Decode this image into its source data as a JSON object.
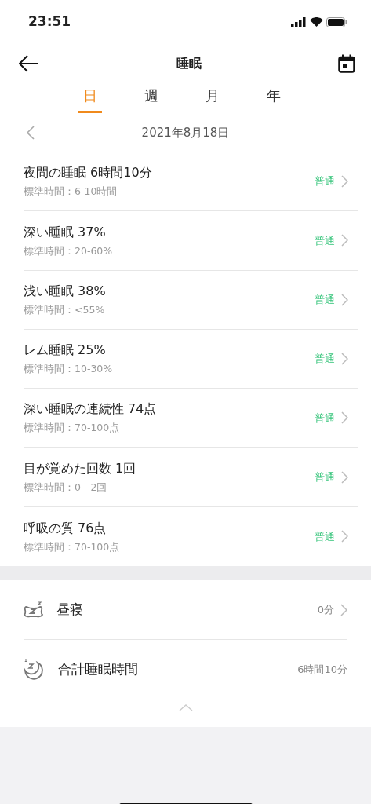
{
  "status_bar": {
    "time": "23:51"
  },
  "header": {
    "title": "睡眠"
  },
  "tabs": [
    {
      "label": "日",
      "selected": true
    },
    {
      "label": "週",
      "selected": false
    },
    {
      "label": "月",
      "selected": false
    },
    {
      "label": "年",
      "selected": false
    }
  ],
  "date": "2021年8月18日",
  "metrics": [
    {
      "title": "夜間の睡眠 6時間10分",
      "standard": "標準時間：6-10時間",
      "rating": "普通"
    },
    {
      "title": "深い睡眠 37%",
      "standard": "標準時間：20-60%",
      "rating": "普通"
    },
    {
      "title": "浅い睡眠 38%",
      "standard": "標準時間：<55%",
      "rating": "普通"
    },
    {
      "title": "レム睡眠 25%",
      "standard": "標準時間：10-30%",
      "rating": "普通"
    },
    {
      "title": "深い睡眠の連続性 74点",
      "standard": "標準時間：70-100点",
      "rating": "普通"
    },
    {
      "title": "目が覚めた回数 1回",
      "standard": "標準時間：0 - 2回",
      "rating": "普通"
    },
    {
      "title": "呼吸の質 76点",
      "standard": "標準時間：70-100点",
      "rating": "普通"
    }
  ],
  "summary": [
    {
      "kind": "nap",
      "label": "昼寝",
      "value": "0分",
      "has_chevron": true
    },
    {
      "kind": "total",
      "label": "合計睡眠時間",
      "value": "6時間10分",
      "has_chevron": false
    }
  ]
}
